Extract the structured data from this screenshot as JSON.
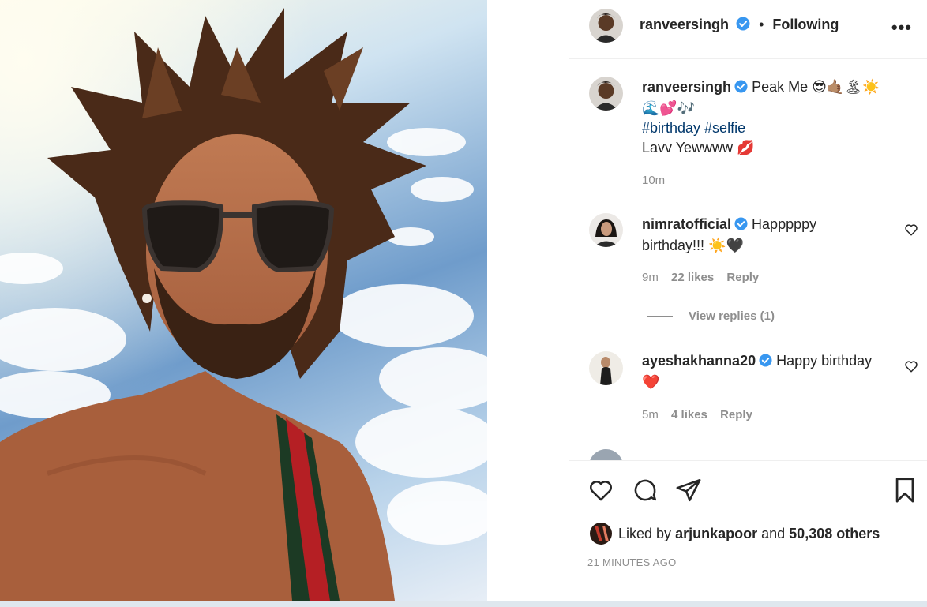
{
  "post": {
    "author": "ranveersingh",
    "following_label": "Following",
    "separator": "•",
    "more_label": "•••",
    "caption": {
      "line1": "Peak Me",
      "line1_emoji": "😎🤙🏽🏝☀️",
      "line2_emoji": "🌊💕🎶",
      "hashtags": "#birthday #selfie",
      "line4": "Lavv Yewwww",
      "line4_emoji": "💋",
      "time": "10m"
    }
  },
  "comments": [
    {
      "user": "nimratofficial",
      "text_line1": "Happpppy",
      "text_line2": "birthday!!! ",
      "text_emoji": "☀️🖤",
      "time": "9m",
      "likes": "22 likes",
      "reply_label": "Reply",
      "view_replies": "View replies (1)"
    },
    {
      "user": "ayeshakhanna20",
      "text_line1": "Happy birthday",
      "text_emoji": "❤️",
      "time": "5m",
      "likes": "4 likes",
      "reply_label": "Reply"
    }
  ],
  "likes": {
    "prefix": "Liked by",
    "user": "arjunkapoor",
    "conj": "and",
    "others": "50,308 others"
  },
  "timestamp": "21 MINUTES AGO",
  "colors": {
    "verified": "#3897f0",
    "hashtag": "#00376b",
    "muted": "#8e8e8e",
    "text": "#262626"
  },
  "icons": [
    "verified-icon",
    "more-icon",
    "heart-icon",
    "comment-icon",
    "share-icon",
    "bookmark-icon"
  ]
}
